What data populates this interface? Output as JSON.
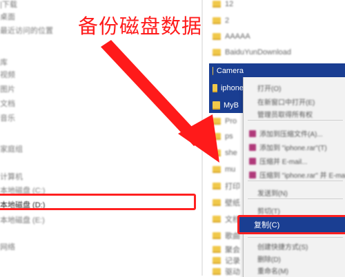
{
  "annotation": {
    "title": "备份磁盘数据",
    "color": "#ff1a1a"
  },
  "nav": {
    "items": [
      {
        "label": "|下载"
      },
      {
        "label": "桌面"
      },
      {
        "label": "最近访问的位置"
      },
      {
        "label": "库"
      },
      {
        "label": "视频"
      },
      {
        "label": "图片"
      },
      {
        "label": "文档"
      },
      {
        "label": "音乐"
      },
      {
        "label": "家庭组"
      },
      {
        "label": "计算机"
      },
      {
        "label": "本地磁盘 (C:)"
      },
      {
        "label": "本地磁盘 (E:)"
      },
      {
        "label": "网络"
      }
    ],
    "selected_drive": "本地磁盘 (D:)"
  },
  "files": {
    "top_rows": [
      "12",
      "2",
      "AAAAA",
      "BaiduYunDownload"
    ],
    "selected": [
      "Camera",
      "iphone",
      "MyB"
    ],
    "bottom_rows": [
      "Pro",
      "ps",
      "she",
      "mu",
      "打印",
      "壁纸",
      "文档",
      "歌曲",
      "聚会",
      "记录",
      "驱动"
    ]
  },
  "context_menu": {
    "items": [
      {
        "label": "打开(O)"
      },
      {
        "label": "在新窗口中打开(E)"
      },
      {
        "label": "管理员取得所有权"
      },
      {
        "label": "添加到压缩文件(A)..."
      },
      {
        "label": "添加到 \"iphone.rar\"(T)"
      },
      {
        "label": "压缩并 E-mail..."
      },
      {
        "label": "压缩到 \"iphone.rar\" 并 E-mail"
      },
      {
        "label": "发送到(N)"
      },
      {
        "label": "剪切(T)"
      },
      {
        "label": "复制(C)"
      },
      {
        "label": "创建快捷方式(S)"
      },
      {
        "label": "删除(D)"
      },
      {
        "label": "重命名(M)"
      }
    ]
  }
}
